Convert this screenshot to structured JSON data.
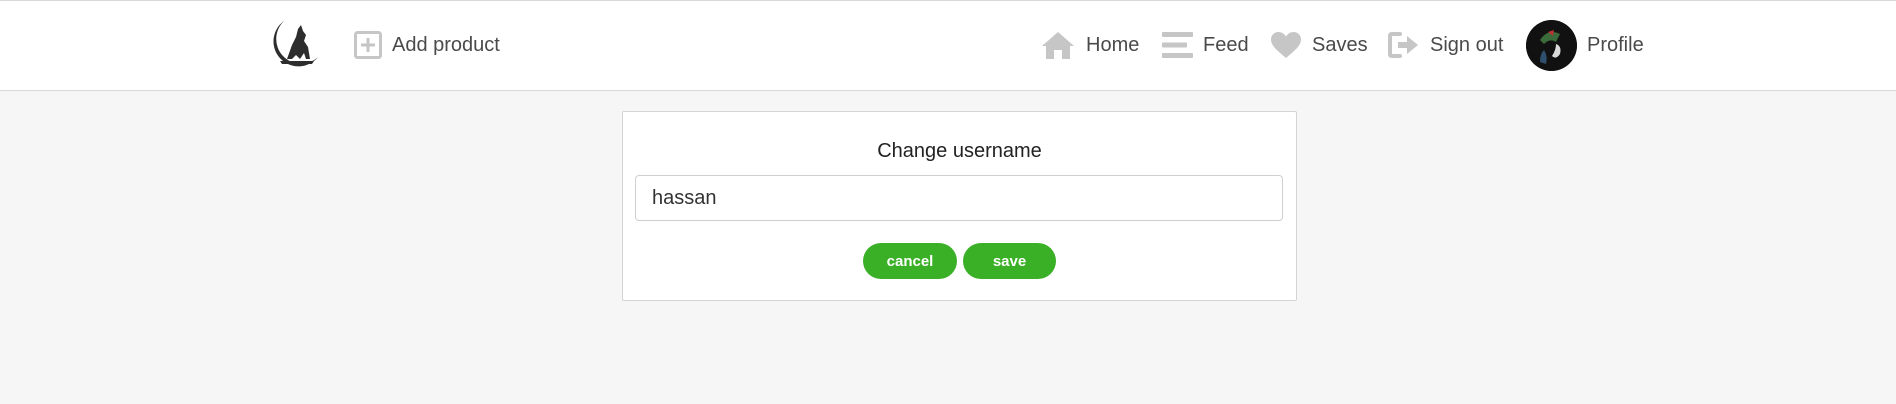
{
  "header": {
    "add_product": "Add product",
    "nav": {
      "home": "Home",
      "feed": "Feed",
      "saves": "Saves",
      "sign_out": "Sign out",
      "profile": "Profile"
    }
  },
  "dialog": {
    "title": "Change username",
    "username_value": "hassan",
    "cancel_label": "cancel",
    "save_label": "save"
  },
  "colors": {
    "accent": "#39b025",
    "nav_icon": "#c6c6c6",
    "background": "#f6f6f6"
  }
}
